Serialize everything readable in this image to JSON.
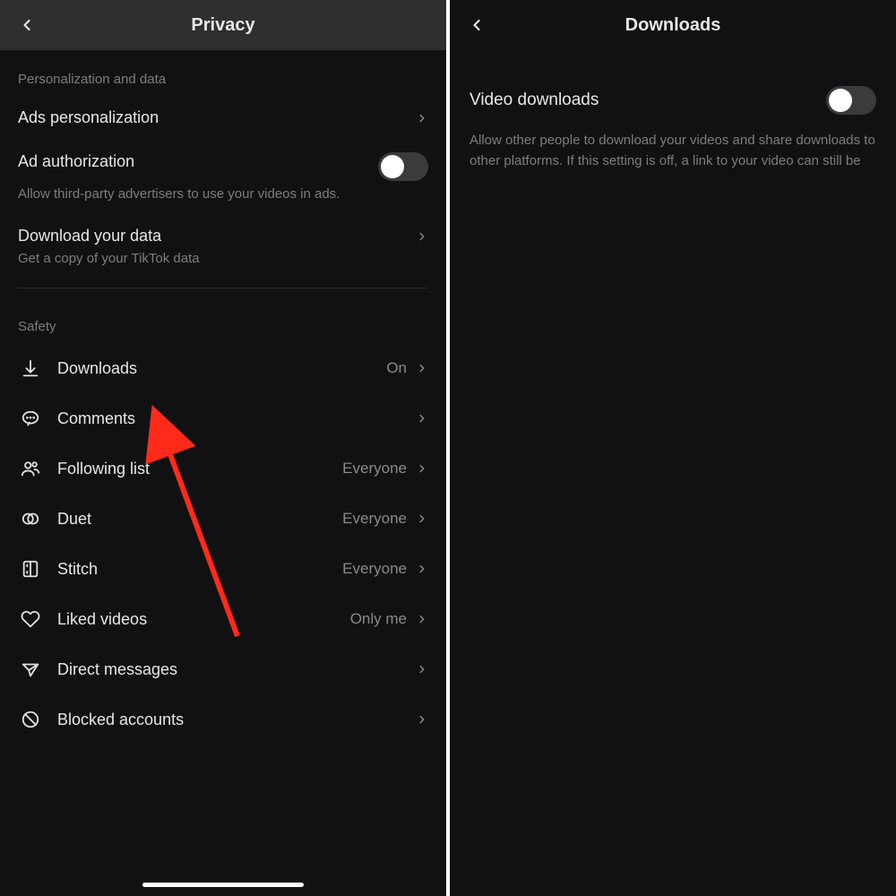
{
  "left": {
    "title": "Privacy",
    "sections": {
      "personalization": {
        "header": "Personalization and data",
        "items": {
          "ads": {
            "label": "Ads personalization"
          },
          "adauth": {
            "label": "Ad authorization",
            "sub": "Allow third-party advertisers to use your videos in ads."
          },
          "dldata": {
            "label": "Download your data",
            "sub": "Get a copy of your TikTok data"
          }
        }
      },
      "safety": {
        "header": "Safety",
        "items": {
          "downloads": {
            "label": "Downloads",
            "value": "On"
          },
          "comments": {
            "label": "Comments"
          },
          "following": {
            "label": "Following list",
            "value": "Everyone"
          },
          "duet": {
            "label": "Duet",
            "value": "Everyone"
          },
          "stitch": {
            "label": "Stitch",
            "value": "Everyone"
          },
          "liked": {
            "label": "Liked videos",
            "value": "Only me"
          },
          "dm": {
            "label": "Direct messages"
          },
          "blocked": {
            "label": "Blocked accounts"
          }
        }
      }
    }
  },
  "right": {
    "title": "Downloads",
    "item": {
      "label": "Video downloads",
      "desc": "Allow other people to download your videos and share downloads to other platforms. If this setting is off, a link to your video can still be",
      "toggle": false
    }
  },
  "annotation": {
    "arrow_color": "#ff2a1a"
  }
}
